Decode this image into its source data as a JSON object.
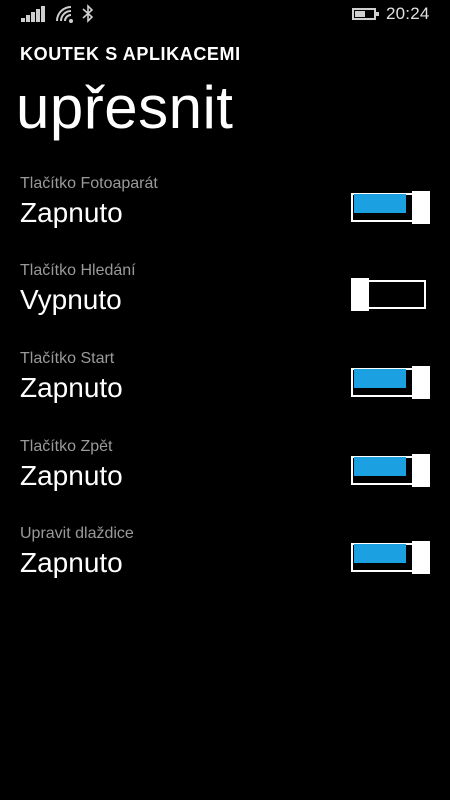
{
  "status_bar": {
    "time": "20:24",
    "signal_icon": "signal-strength-icon",
    "wifi_icon": "wifi-icon",
    "bluetooth_icon": "bluetooth-icon",
    "battery_icon": "battery-icon",
    "battery_level": 0.55
  },
  "header": {
    "app_title": "KOUTEK S APLIKACEMI",
    "page_title": "upřesnit"
  },
  "settings": [
    {
      "label": "Tlačítko Fotoaparát",
      "value": "Zapnuto",
      "on": true
    },
    {
      "label": "Tlačítko Hledání",
      "value": "Vypnuto",
      "on": false
    },
    {
      "label": "Tlačítko Start",
      "value": "Zapnuto",
      "on": true
    },
    {
      "label": "Tlačítko Zpět",
      "value": "Zapnuto",
      "on": true
    },
    {
      "label": "Upravit dlaždice",
      "value": "Zapnuto",
      "on": true
    }
  ],
  "colors": {
    "accent": "#1ba1e2",
    "background": "#000000",
    "label": "#9a9a9a"
  }
}
